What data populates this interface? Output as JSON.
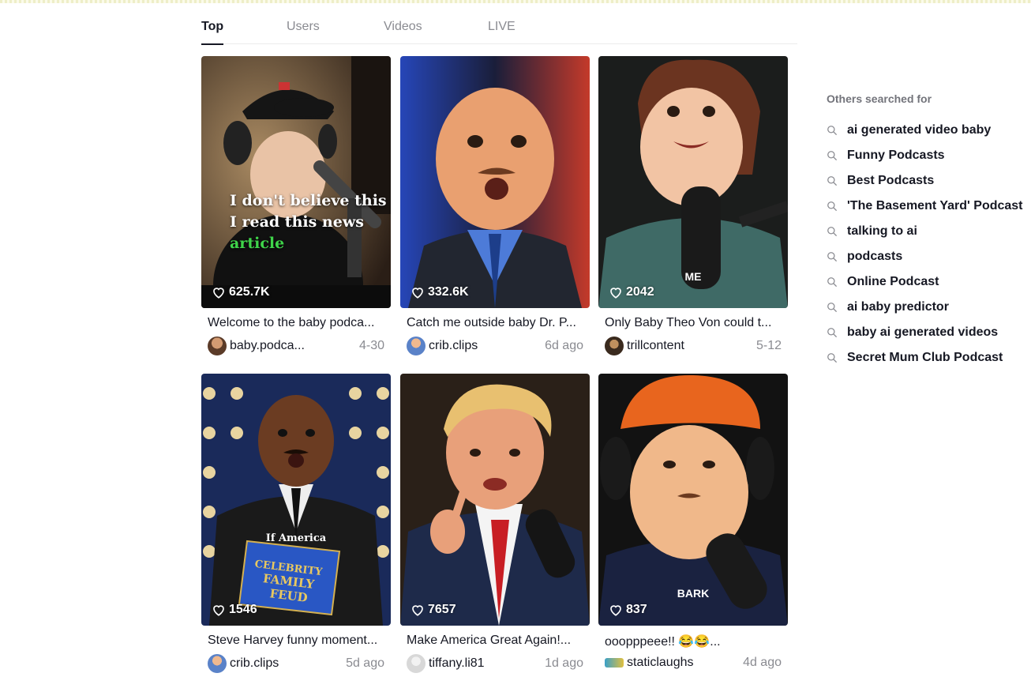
{
  "tabs": [
    {
      "label": "Top",
      "active": true
    },
    {
      "label": "Users",
      "active": false
    },
    {
      "label": "Videos",
      "active": false
    },
    {
      "label": "LIVE",
      "active": false
    }
  ],
  "videos": [
    {
      "likes": "625.7K",
      "title": "Welcome to the baby podca...",
      "user": "baby.podca...",
      "date": "4-30",
      "overlay_lines": [
        "I don't believe this",
        "I read this news"
      ],
      "overlay_highlight": "article"
    },
    {
      "likes": "332.6K",
      "title": "Catch me outside baby Dr. P...",
      "user": "crib.clips",
      "date": "6d ago"
    },
    {
      "likes": "2042",
      "title": "Only Baby Theo Von could t...",
      "user": "trillcontent",
      "date": "5-12",
      "overlay": "ME"
    },
    {
      "likes": "1546",
      "title": "Steve Harvey funny moment...",
      "user": "crib.clips",
      "date": "5d ago",
      "overlay": "If America",
      "sign_text": "CELEBRITY FAMILY FEUD"
    },
    {
      "likes": "7657",
      "title": "Make America Great Again!...",
      "user": "tiffany.li81",
      "date": "1d ago"
    },
    {
      "likes": "837",
      "title": "ooopppeee!! 😂😂...",
      "user": "staticlaughs",
      "date": "4d ago",
      "overlay": "BARK"
    }
  ],
  "sidebar": {
    "heading": "Others searched for",
    "items": [
      "ai generated video baby",
      "Funny Podcasts",
      "Best Podcasts",
      "'The Basement Yard' Podcast",
      "talking to ai",
      "podcasts",
      "Online Podcast",
      "ai baby predictor",
      "baby ai generated videos",
      "Secret Mum Club Podcast"
    ]
  },
  "icons": {
    "like": "heart-outline-icon",
    "search": "magnifier-icon"
  },
  "colors": {
    "text": "#161823",
    "muted": "#8a8b91",
    "overlay_green": "#3fd44a"
  }
}
